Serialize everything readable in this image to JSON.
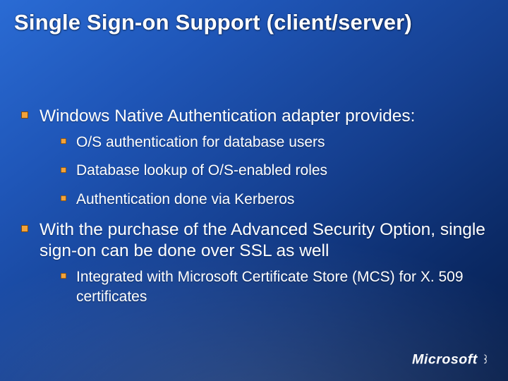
{
  "title": "Single Sign-on Support (client/server)",
  "bullets": [
    {
      "text": "Windows Native Authentication adapter provides:",
      "children": [
        {
          "text": "O/S authentication for database users"
        },
        {
          "text": "Database lookup of O/S-enabled roles"
        },
        {
          "text": "Authentication done via Kerberos"
        }
      ]
    },
    {
      "text": "With the purchase of the Advanced Security Option, single sign-on can be done over SSL as well",
      "children": [
        {
          "text": "Integrated with Microsoft Certificate Store (MCS) for X. 509 certificates"
        }
      ]
    }
  ],
  "footer": {
    "brand": "Microsoft"
  },
  "colors": {
    "bullet_fill": "#f3a33a",
    "bullet_edge": "#7a4b12"
  }
}
